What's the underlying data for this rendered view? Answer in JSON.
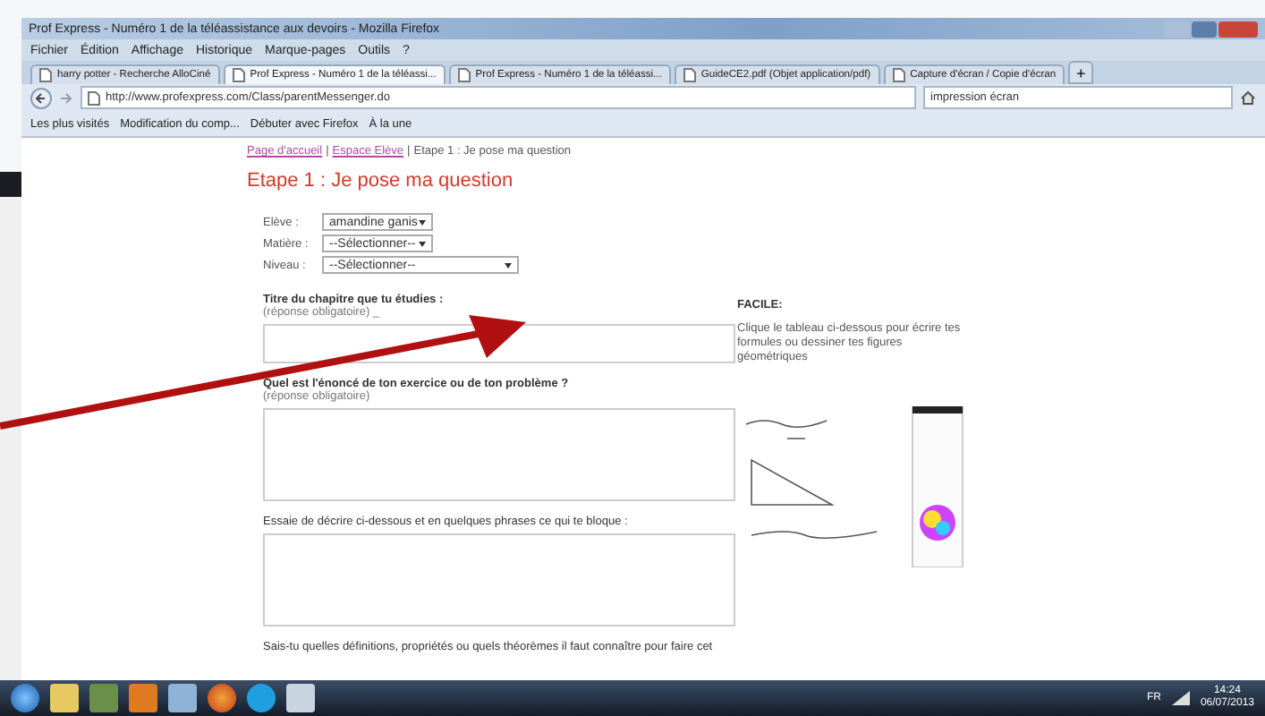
{
  "window": {
    "title": "Prof Express - Numéro 1 de la téléassistance aux devoirs - Mozilla Firefox"
  },
  "menu": [
    "Fichier",
    "Édition",
    "Affichage",
    "Historique",
    "Marque-pages",
    "Outils",
    "?"
  ],
  "tabs": [
    {
      "label": "harry potter - Recherche AlloCiné",
      "selected": false
    },
    {
      "label": "Prof Express - Numéro 1 de la téléassi...",
      "selected": true
    },
    {
      "label": "Prof Express - Numéro 1 de la téléassi...",
      "selected": false
    },
    {
      "label": "GuideCE2.pdf (Objet application/pdf)",
      "selected": false
    },
    {
      "label": "Capture d'écran / Copie d'écran",
      "selected": false
    }
  ],
  "new_tab": "+",
  "address": "http://www.profexpress.com/Class/parentMessenger.do",
  "search": {
    "value": "impression écran"
  },
  "bookmarks": [
    "Les plus visités",
    "Modification du comp...",
    "Débuter avec Firefox",
    "À la une"
  ],
  "page": {
    "breadcrumb": [
      {
        "text": "Page d'accueil",
        "link": true
      },
      {
        "text": "Espace Elève",
        "link": true
      },
      {
        "text": "Etape 1 : Je pose ma question",
        "link": false
      }
    ],
    "separator": "|",
    "heading": "Etape 1 : Je pose ma question",
    "fields": [
      {
        "label": "Elève :",
        "value": "amandine ganis",
        "kind": "narrow"
      },
      {
        "label": "Matière :",
        "value": "--Sélectionner--",
        "kind": "narrow"
      },
      {
        "label": "Niveau :",
        "value": "--Sélectionner--",
        "kind": "wide"
      }
    ],
    "questions": [
      {
        "title": "Titre du chapitre que tu étudies :",
        "note": "(réponse obligatoire) _",
        "bold": true,
        "kind": "short"
      },
      {
        "title": "Quel est l'énoncé de ton exercice ou de ton problème ?",
        "note": "(réponse obligatoire)",
        "bold": true,
        "kind": "long"
      },
      {
        "title": "Essaie de décrire ci-dessous et en quelques phrases ce qui te bloque :",
        "bold": false,
        "kind": "long"
      },
      {
        "title": "Sais-tu quelles définitions, propriétés ou quels théorèmes il faut connaître pour faire cet",
        "bold": false,
        "kind": "text"
      }
    ],
    "tip": {
      "title": "FACILE:",
      "text": "Clique le tableau ci-dessous pour écrire tes formules ou dessiner tes figures géométriques"
    }
  },
  "taskbar": {
    "language": "FR",
    "time": "14:24",
    "date": "06/07/2013"
  }
}
